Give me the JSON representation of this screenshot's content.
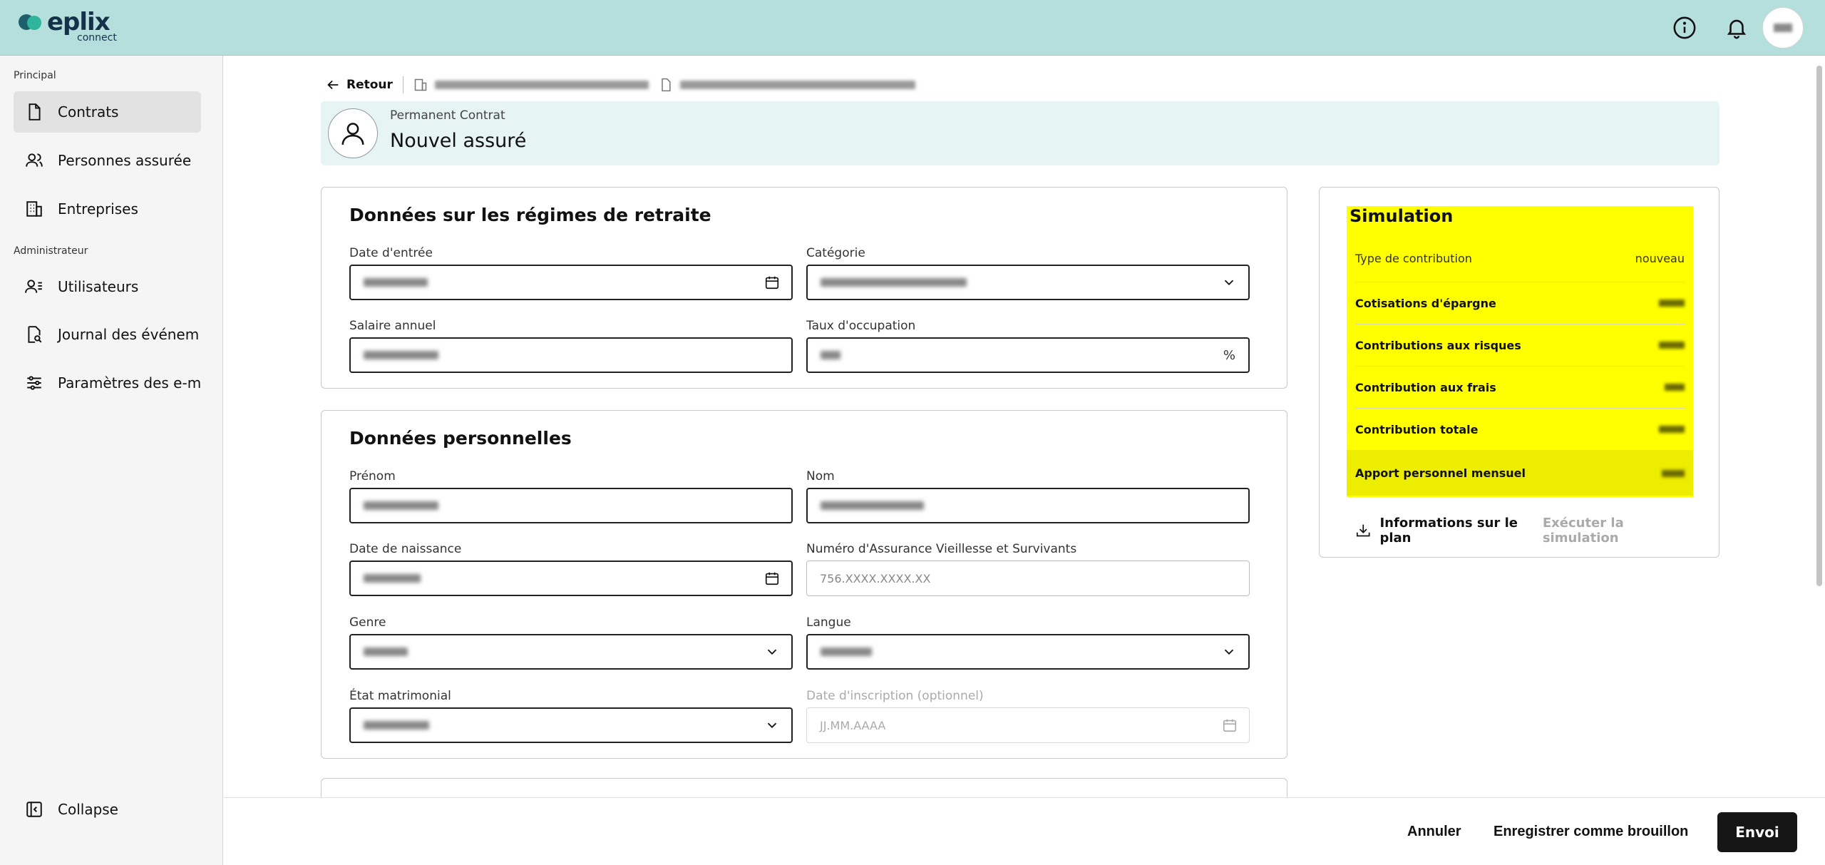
{
  "brand": {
    "name": "eplix",
    "sub": "connect"
  },
  "sidebar": {
    "section_main": "Principal",
    "section_admin": "Administrateur",
    "items": [
      {
        "label": "Contrats"
      },
      {
        "label": "Personnes assurée"
      },
      {
        "label": "Entreprises"
      },
      {
        "label": "Utilisateurs"
      },
      {
        "label": "Journal des événem"
      },
      {
        "label": "Paramètres des e-m"
      }
    ],
    "collapse": "Collapse"
  },
  "breadcrumb": {
    "back": "Retour"
  },
  "header": {
    "subtitle": "Permanent Contrat",
    "title": "Nouvel assuré"
  },
  "pension": {
    "title": "Données sur les régimes de retraite",
    "entry_date_label": "Date d'entrée",
    "category_label": "Catégorie",
    "salary_label": "Salaire annuel",
    "occupation_label": "Taux d'occupation",
    "occupation_suffix": "%"
  },
  "personal": {
    "title": "Données personnelles",
    "firstname_label": "Prénom",
    "lastname_label": "Nom",
    "birthdate_label": "Date de naissance",
    "avs_label": "Numéro d'Assurance Vieillesse et Survivants",
    "avs_placeholder": "756.XXXX.XXXX.XX",
    "gender_label": "Genre",
    "language_label": "Langue",
    "marital_label": "État matrimonial",
    "registration_label": "Date d'inscription (optionnel)",
    "registration_placeholder": "JJ.MM.AAAA"
  },
  "simulation": {
    "title": "Simulation",
    "type_label": "Type de contribution",
    "type_value": "nouveau",
    "rows": [
      {
        "label": "Cotisations d'épargne"
      },
      {
        "label": "Contributions aux risques"
      },
      {
        "label": "Contribution aux frais"
      },
      {
        "label": "Contribution totale"
      },
      {
        "label": "Apport personnel mensuel"
      }
    ],
    "plan_info": "Informations sur le plan",
    "run": "Exécuter la simulation"
  },
  "footer": {
    "cancel": "Annuler",
    "draft": "Enregistrer comme brouillon",
    "submit": "Envoi"
  },
  "colors": {
    "topbar": "#b5dfdd",
    "header_card": "#e6f4f3",
    "highlight": "#ffff00",
    "primary_button": "#161616"
  }
}
